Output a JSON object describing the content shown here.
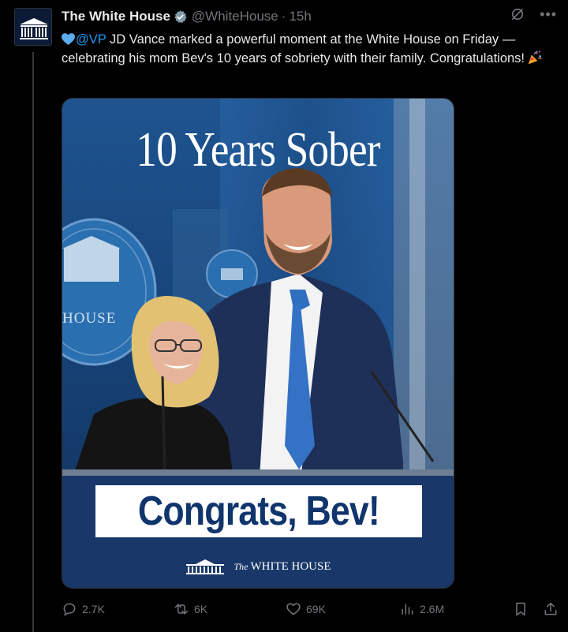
{
  "account": {
    "display_name": "The White House",
    "handle": "@WhiteHouse",
    "separator": "·",
    "time": "15h"
  },
  "icons": {
    "avatar": "white-house-logo",
    "verified": "gray-verified-badge",
    "grok": "grok-icon",
    "more": "more-dots-icon"
  },
  "tweet": {
    "mention": "@VP",
    "text": " JD Vance marked a powerful moment at the White House on Friday —celebrating his mom Bev's 10 years of sobriety with their family. Congratulations!"
  },
  "media": {
    "headline": "10 Years Sober",
    "banner": "Congrats, Bev!",
    "seal_text": "HOUSE",
    "logo_the": "The",
    "logo_name": "WHITE HOUSE"
  },
  "actions": {
    "replies": "2.7K",
    "reposts": "6K",
    "likes": "69K",
    "views": "2.6M"
  },
  "colors": {
    "background": "#000000",
    "accent": "#1d9bf0",
    "muted": "#71767b",
    "banner_text": "#10356d"
  }
}
